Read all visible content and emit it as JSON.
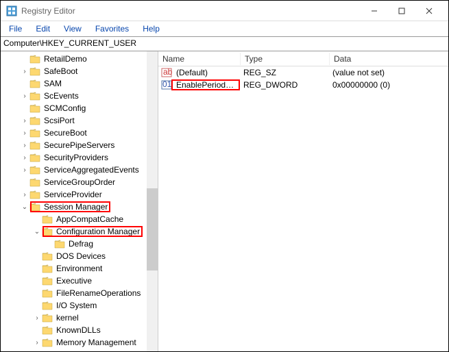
{
  "window": {
    "title": "Registry Editor"
  },
  "menu": {
    "file": "File",
    "edit": "Edit",
    "view": "View",
    "favorites": "Favorites",
    "help": "Help"
  },
  "address": "Computer\\HKEY_CURRENT_USER",
  "tree": {
    "indent_base": 28,
    "items": [
      {
        "label": "RetailDemo",
        "depth": 0,
        "exp": ""
      },
      {
        "label": "SafeBoot",
        "depth": 0,
        "exp": ">"
      },
      {
        "label": "SAM",
        "depth": 0,
        "exp": ""
      },
      {
        "label": "ScEvents",
        "depth": 0,
        "exp": ">"
      },
      {
        "label": "SCMConfig",
        "depth": 0,
        "exp": ""
      },
      {
        "label": "ScsiPort",
        "depth": 0,
        "exp": ">"
      },
      {
        "label": "SecureBoot",
        "depth": 0,
        "exp": ">"
      },
      {
        "label": "SecurePipeServers",
        "depth": 0,
        "exp": ">"
      },
      {
        "label": "SecurityProviders",
        "depth": 0,
        "exp": ">"
      },
      {
        "label": "ServiceAggregatedEvents",
        "depth": 0,
        "exp": ">"
      },
      {
        "label": "ServiceGroupOrder",
        "depth": 0,
        "exp": ""
      },
      {
        "label": "ServiceProvider",
        "depth": 0,
        "exp": ">"
      },
      {
        "label": "Session Manager",
        "depth": 0,
        "exp": "v",
        "hl": true
      },
      {
        "label": "AppCompatCache",
        "depth": 1,
        "exp": ""
      },
      {
        "label": "Configuration Manager",
        "depth": 1,
        "exp": "v",
        "hl": true
      },
      {
        "label": "Defrag",
        "depth": 2,
        "exp": ""
      },
      {
        "label": "DOS Devices",
        "depth": 1,
        "exp": ""
      },
      {
        "label": "Environment",
        "depth": 1,
        "exp": ""
      },
      {
        "label": "Executive",
        "depth": 1,
        "exp": ""
      },
      {
        "label": "FileRenameOperations",
        "depth": 1,
        "exp": ""
      },
      {
        "label": "I/O System",
        "depth": 1,
        "exp": ""
      },
      {
        "label": "kernel",
        "depth": 1,
        "exp": ">"
      },
      {
        "label": "KnownDLLs",
        "depth": 1,
        "exp": ""
      },
      {
        "label": "Memory Management",
        "depth": 1,
        "exp": ">"
      }
    ]
  },
  "list": {
    "headers": {
      "name": "Name",
      "type": "Type",
      "data": "Data"
    },
    "rows": [
      {
        "icon": "str",
        "name": "(Default)",
        "type": "REG_SZ",
        "data": "(value not set)",
        "hl": false
      },
      {
        "icon": "bin",
        "name": "EnablePeriodicB...",
        "type": "REG_DWORD",
        "data": "0x00000000 (0)",
        "hl": true
      }
    ]
  }
}
